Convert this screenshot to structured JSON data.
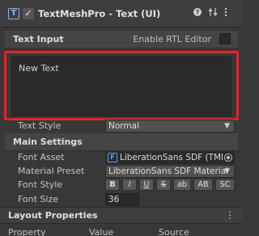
{
  "component": {
    "title": "TextMeshPro - Text (UI)",
    "icon": "text-component-icon",
    "enabled": true,
    "header_icons": [
      "help-icon",
      "preset-icon",
      "kebab-menu-icon"
    ]
  },
  "text_input": {
    "section_title": "Text Input",
    "rtl_label": "Enable RTL Editor",
    "rtl_checked": false,
    "value": "New Text"
  },
  "text_style": {
    "label": "Text Style",
    "value": "Normal"
  },
  "main_settings": {
    "section_title": "Main Settings",
    "font_asset": {
      "label": "Font Asset",
      "value": "LiberationSans SDF (TMI",
      "icon": "font-asset-icon"
    },
    "material_preset": {
      "label": "Material Preset",
      "value": "LiberationSans SDF Material"
    },
    "font_style": {
      "label": "Font Style",
      "buttons": [
        "B",
        "I",
        "U",
        "S",
        "ab",
        "AB",
        "SC"
      ]
    },
    "font_size": {
      "label": "Font Size",
      "value": "36"
    }
  },
  "layout_properties": {
    "title": "Layout Properties",
    "columns": [
      "Property",
      "Value",
      "Source"
    ]
  },
  "colors": {
    "highlight": "#e0242a",
    "panel": "#383838",
    "field_dark": "#2a2a2a",
    "dropdown": "#515151"
  }
}
